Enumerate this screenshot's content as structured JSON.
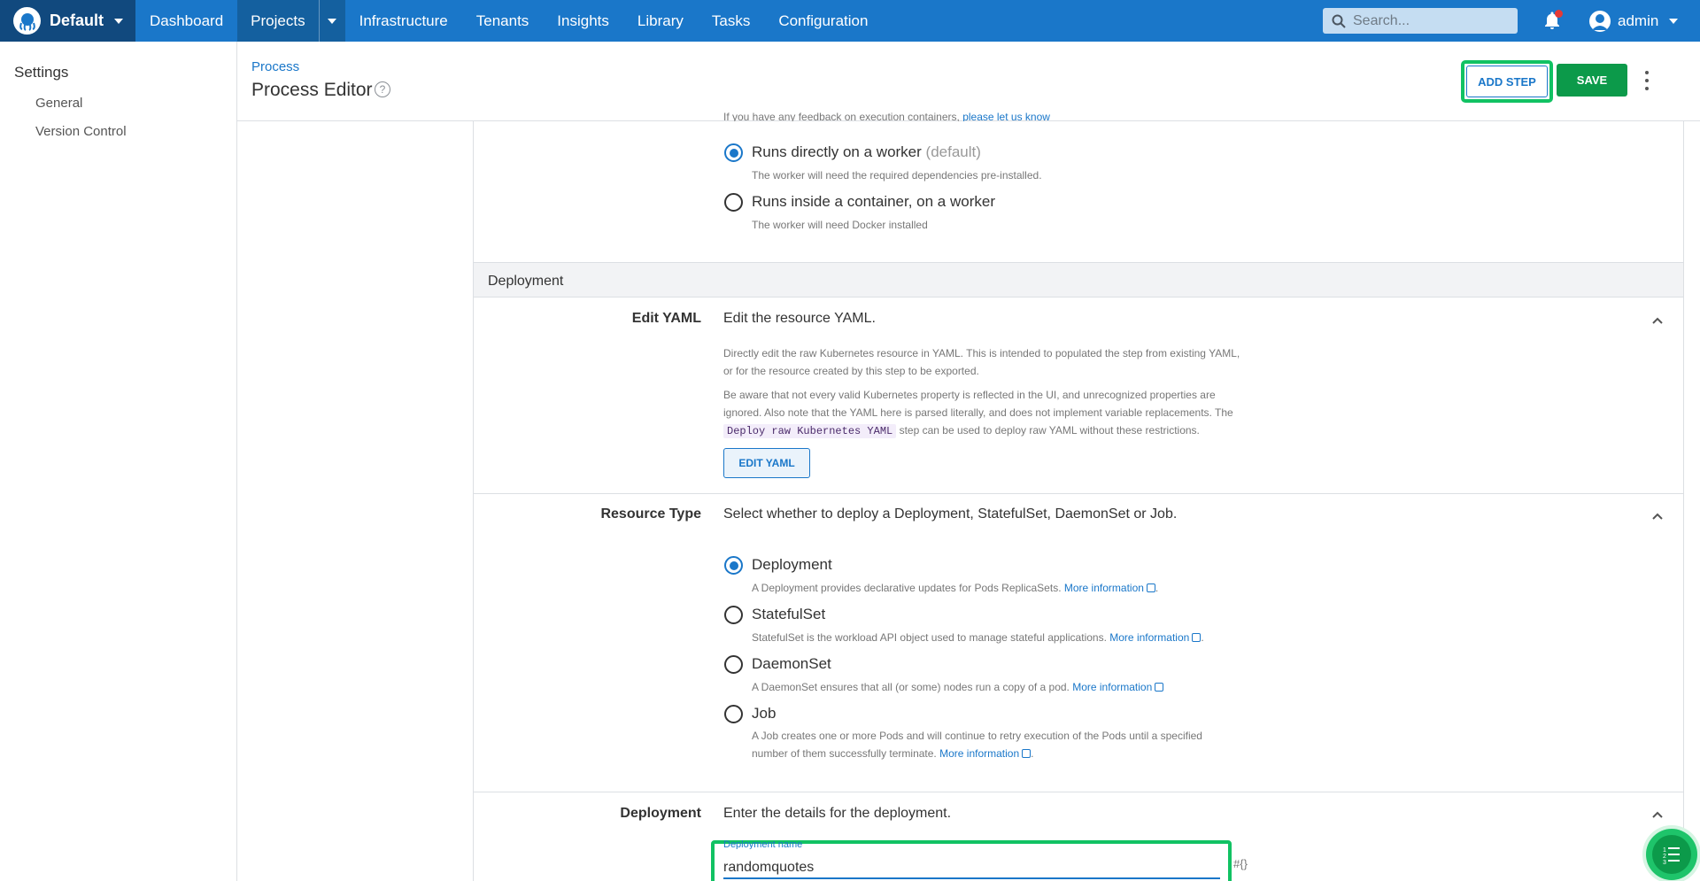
{
  "topnav": {
    "space_name": "Default",
    "items": [
      "Dashboard",
      "Projects",
      "Infrastructure",
      "Tenants",
      "Insights",
      "Library",
      "Tasks",
      "Configuration"
    ],
    "active_item": "Projects",
    "search_placeholder": "Search...",
    "user_name": "admin"
  },
  "sidebar": {
    "heading": "Settings",
    "links": [
      "General",
      "Version Control"
    ]
  },
  "header": {
    "breadcrumb": "Process",
    "title": "Process Editor",
    "add_step_label": "ADD STEP",
    "save_label": "SAVE"
  },
  "execution": {
    "feedback_text": "If you have any feedback on execution containers,",
    "feedback_link": "please let us know",
    "options": [
      {
        "label": "Runs directly on a worker",
        "suffix": "(default)",
        "help": "The worker will need the required dependencies pre-installed.",
        "checked": true
      },
      {
        "label": "Runs inside a container, on a worker",
        "suffix": "",
        "help": "The worker will need Docker installed",
        "checked": false
      }
    ]
  },
  "deployment_section": {
    "title": "Deployment"
  },
  "edit_yaml": {
    "label": "Edit YAML",
    "summary": "Edit the resource YAML.",
    "desc1_line1": "Directly edit the raw Kubernetes resource in YAML. This is intended to populated the step from existing YAML,",
    "desc1_line2": "or for the resource created by this step to be exported.",
    "desc2_line1": "Be aware that not every valid Kubernetes property is reflected in the UI, and unrecognized properties are",
    "desc2_line2": "ignored. Also note that the YAML here is parsed literally, and does not implement variable replacements. The",
    "desc2_code": "Deploy raw Kubernetes YAML",
    "desc2_line3_tail": "step can be used to deploy raw YAML without these restrictions.",
    "button_label": "EDIT YAML"
  },
  "resource_type": {
    "label": "Resource Type",
    "summary": "Select whether to deploy a Deployment, StatefulSet, DaemonSet or Job.",
    "more_info": "More information",
    "options": [
      {
        "label": "Deployment",
        "help": "A Deployment provides declarative updates for Pods ReplicaSets.",
        "checked": true
      },
      {
        "label": "StatefulSet",
        "help": "StatefulSet is the workload API object used to manage stateful applications.",
        "checked": false
      },
      {
        "label": "DaemonSet",
        "help": "A DaemonSet ensures that all (or some) nodes run a copy of a pod.",
        "checked": false
      },
      {
        "label": "Job",
        "help_line1": "A Job creates one or more Pods and will continue to retry execution of the Pods until a specified",
        "help_line2": "number of them successfully terminate.",
        "checked": false
      }
    ]
  },
  "deployment_details": {
    "label": "Deployment",
    "summary": "Enter the details for the deployment.",
    "name_label": "Deployment name",
    "name_value": "randomquotes",
    "variable_binding": "#{}"
  },
  "colors": {
    "nav": "#1a77c9",
    "nav_dark": "#11497e",
    "accent": "#1a77c9",
    "save": "#0c9a4a",
    "highlight": "#11c263"
  },
  "icons": [
    "octopus-logo-icon",
    "search-icon",
    "bell-icon",
    "user-avatar-icon",
    "help-circle-icon",
    "more-vert-icon",
    "chevron-up-icon",
    "external-link-icon",
    "list-numbered-icon"
  ]
}
